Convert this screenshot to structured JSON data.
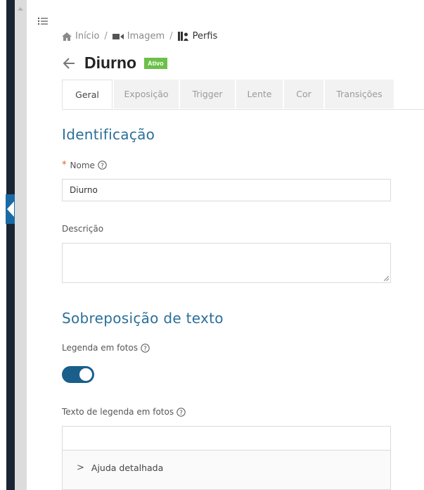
{
  "breadcrumb": {
    "items": [
      {
        "label": "Início",
        "icon": "home-icon"
      },
      {
        "label": "Imagem",
        "icon": "video-camera-icon"
      },
      {
        "label": "Perfis",
        "icon": "profiles-icon"
      }
    ],
    "separator": "/"
  },
  "header": {
    "title": "Diurno",
    "status_badge": "Ativo"
  },
  "tabs": [
    {
      "label": "Geral",
      "active": true
    },
    {
      "label": "Exposição",
      "active": false
    },
    {
      "label": "Trigger",
      "active": false
    },
    {
      "label": "Lente",
      "active": false
    },
    {
      "label": "Cor",
      "active": false
    },
    {
      "label": "Transições",
      "active": false
    }
  ],
  "identification": {
    "section_title": "Identificação",
    "name_label": "Nome",
    "name_required_mark": "*",
    "name_value": "Diurno",
    "description_label": "Descrição",
    "description_value": ""
  },
  "overlay": {
    "section_title": "Sobreposição de texto",
    "caption_toggle_label": "Legenda em fotos",
    "caption_toggle_on": true,
    "caption_text_label": "Texto de legenda em fotos",
    "caption_text_value": "",
    "detailed_help_label": "Ajuda detalhada",
    "detailed_help_chevron": ">"
  },
  "colors": {
    "accent": "#2b6f99",
    "toggle_on": "#1a5f8c",
    "badge_green": "#6cc04a",
    "required": "#e0602a",
    "sidebar_dark": "#1b2433",
    "collapse_tab": "#1a6aa5"
  }
}
